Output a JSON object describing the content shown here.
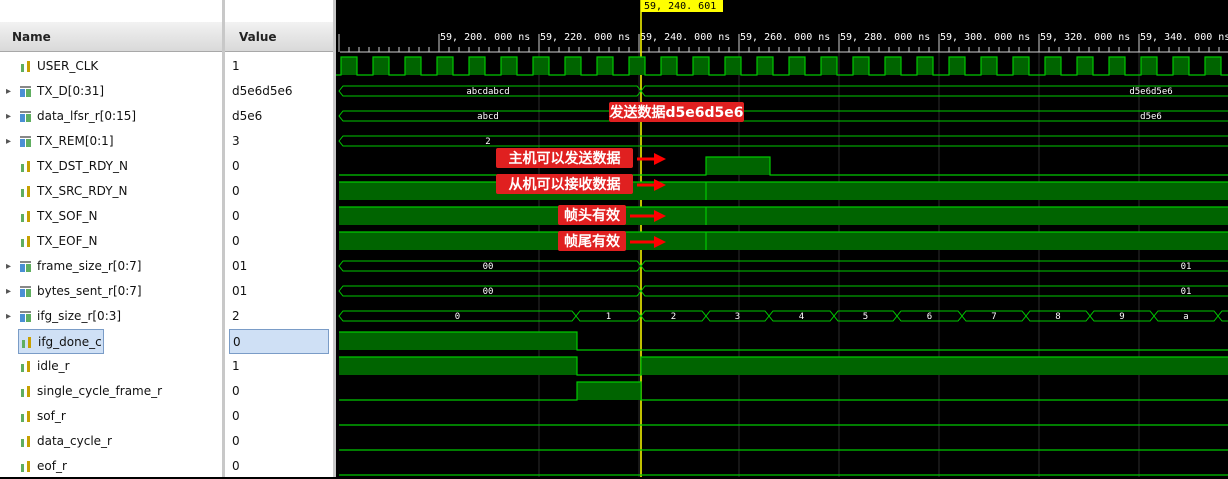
{
  "headers": {
    "name": "Name",
    "value": "Value"
  },
  "signals": [
    {
      "name": "USER_CLK",
      "value": "1",
      "type": "bit",
      "expand": false
    },
    {
      "name": "TX_D[0:31]",
      "value": "d5e6d5e6",
      "type": "bus",
      "expand": true
    },
    {
      "name": "data_lfsr_r[0:15]",
      "value": "d5e6",
      "type": "bus",
      "expand": true
    },
    {
      "name": "TX_REM[0:1]",
      "value": "3",
      "type": "bus",
      "expand": true
    },
    {
      "name": "TX_DST_RDY_N",
      "value": "0",
      "type": "bit",
      "expand": false
    },
    {
      "name": "TX_SRC_RDY_N",
      "value": "0",
      "type": "bit",
      "expand": false
    },
    {
      "name": "TX_SOF_N",
      "value": "0",
      "type": "bit",
      "expand": false
    },
    {
      "name": "TX_EOF_N",
      "value": "0",
      "type": "bit",
      "expand": false
    },
    {
      "name": "frame_size_r[0:7]",
      "value": "01",
      "type": "bus",
      "expand": true
    },
    {
      "name": "bytes_sent_r[0:7]",
      "value": "01",
      "type": "bus",
      "expand": true
    },
    {
      "name": "ifg_size_r[0:3]",
      "value": "2",
      "type": "bus",
      "expand": true
    },
    {
      "name": "ifg_done_c",
      "value": "0",
      "type": "bit",
      "expand": false,
      "selected": true
    },
    {
      "name": "idle_r",
      "value": "1",
      "type": "bit",
      "expand": false
    },
    {
      "name": "single_cycle_frame_r",
      "value": "0",
      "type": "bit",
      "expand": false
    },
    {
      "name": "sof_r",
      "value": "0",
      "type": "bit",
      "expand": false
    },
    {
      "name": "data_cycle_r",
      "value": "0",
      "type": "bit",
      "expand": false
    },
    {
      "name": "eof_r",
      "value": "0",
      "type": "bit",
      "expand": false
    }
  ],
  "timeline": {
    "cursor": "59, 240. 601 ns",
    "ticks": [
      "59, 200. 000 ns",
      "59, 220. 000 ns",
      "59, 240. 000 ns",
      "59, 260. 000 ns",
      "59, 280. 000 ns",
      "59, 300. 000 ns",
      "59, 320. 000 ns",
      "59, 340. 000 ns"
    ]
  },
  "bus_values": {
    "tx_d_before": "abcdabcd",
    "tx_d_after": "d5e6d5e6",
    "lfsr_before": "abcd",
    "lfsr_after": "d5e6",
    "tx_rem": "2",
    "frame_size_before": "00",
    "frame_size_after": "01",
    "bytes_sent_before": "00",
    "bytes_sent_after": "01",
    "ifg": [
      "0",
      "1",
      "2",
      "3",
      "4",
      "5",
      "6",
      "7",
      "8",
      "9",
      "a"
    ]
  },
  "annotations": {
    "send_data": "发送数据d5e6d5e6",
    "host_send": "主机可以发送数据",
    "slave_recv": "从机可以接收数据",
    "sof_valid": "帧头有效",
    "eof_valid": "帧尾有效"
  },
  "colors": {
    "wave": "#00c800",
    "fill": "#006400",
    "cursor": "#ffff00",
    "anno_bg": "#e02020",
    "arrow": "#ff0000"
  }
}
